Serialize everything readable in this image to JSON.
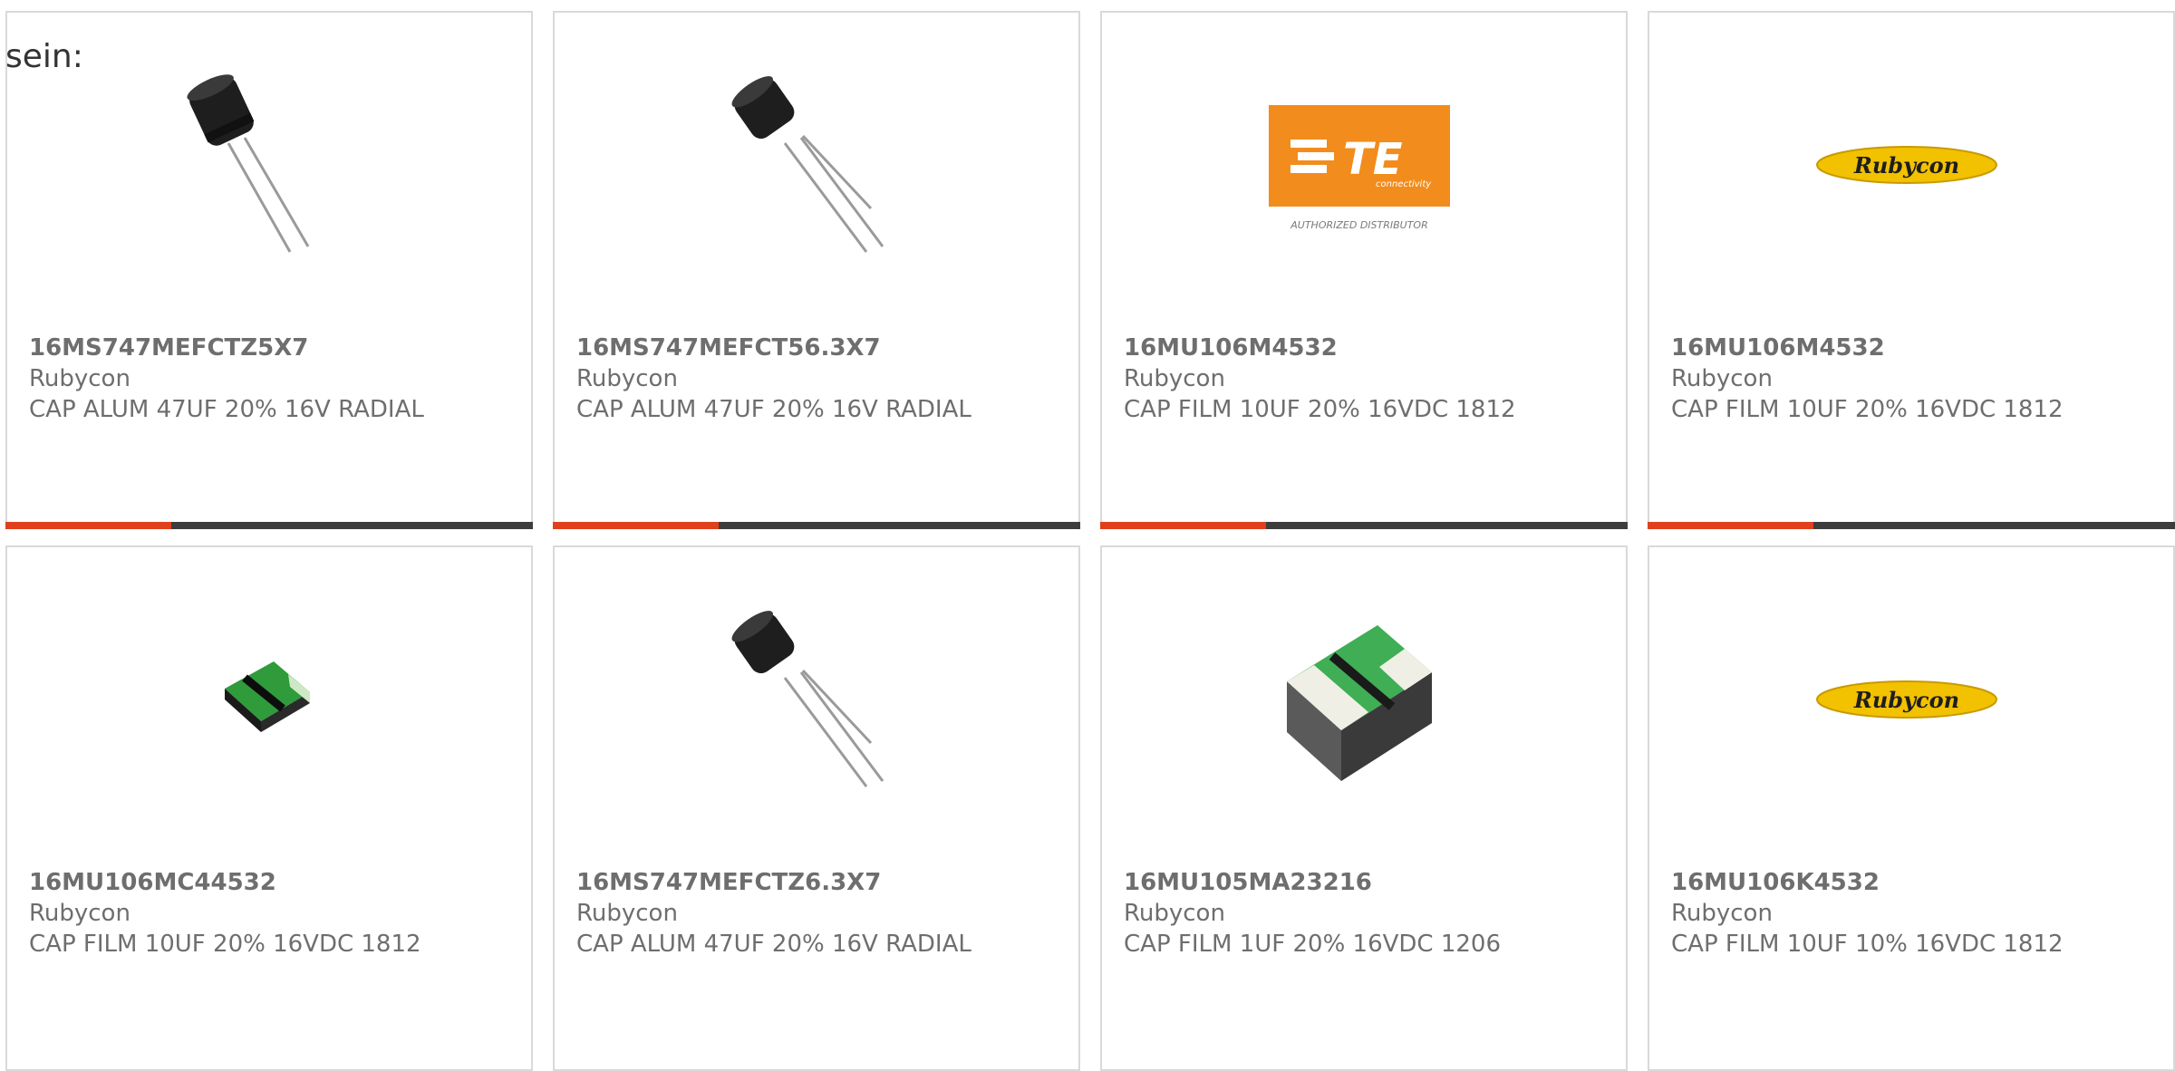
{
  "intro_text": "sein:",
  "accent_color": "#e0401b",
  "products": [
    {
      "part_number": "16MS747MEFCTZ5X7",
      "manufacturer": "Rubycon",
      "description": "CAP ALUM 47UF 20% 16V RADIAL",
      "image": "radial-capacitor"
    },
    {
      "part_number": "16MS747MEFCT56.3X7",
      "manufacturer": "Rubycon",
      "description": "CAP ALUM 47UF 20% 16V RADIAL",
      "image": "radial-capacitor"
    },
    {
      "part_number": "16MU106M4532",
      "manufacturer": "Rubycon",
      "description": "CAP FILM 10UF 20% 16VDC 1812",
      "image": "te-connectivity-logo",
      "logo_text": "TE",
      "logo_subtext": "connectivity",
      "logo_caption": "AUTHORIZED DISTRIBUTOR"
    },
    {
      "part_number": "16MU106M4532",
      "manufacturer": "Rubycon",
      "description": "CAP FILM 10UF 20% 16VDC 1812",
      "image": "rubycon-logo",
      "logo_text": "Rubycon"
    },
    {
      "part_number": "16MU106MC44532",
      "manufacturer": "Rubycon",
      "description": "CAP FILM 10UF 20% 16VDC 1812",
      "image": "film-chip-capacitor"
    },
    {
      "part_number": "16MS747MEFCTZ6.3X7",
      "manufacturer": "Rubycon",
      "description": "CAP ALUM 47UF 20% 16V RADIAL",
      "image": "radial-capacitor"
    },
    {
      "part_number": "16MU105MA23216",
      "manufacturer": "Rubycon",
      "description": "CAP FILM 1UF 20% 16VDC 1206",
      "image": "film-chip-capacitor"
    },
    {
      "part_number": "16MU106K4532",
      "manufacturer": "Rubycon",
      "description": "CAP FILM 10UF 10% 16VDC 1812",
      "image": "rubycon-logo",
      "logo_text": "Rubycon"
    }
  ]
}
